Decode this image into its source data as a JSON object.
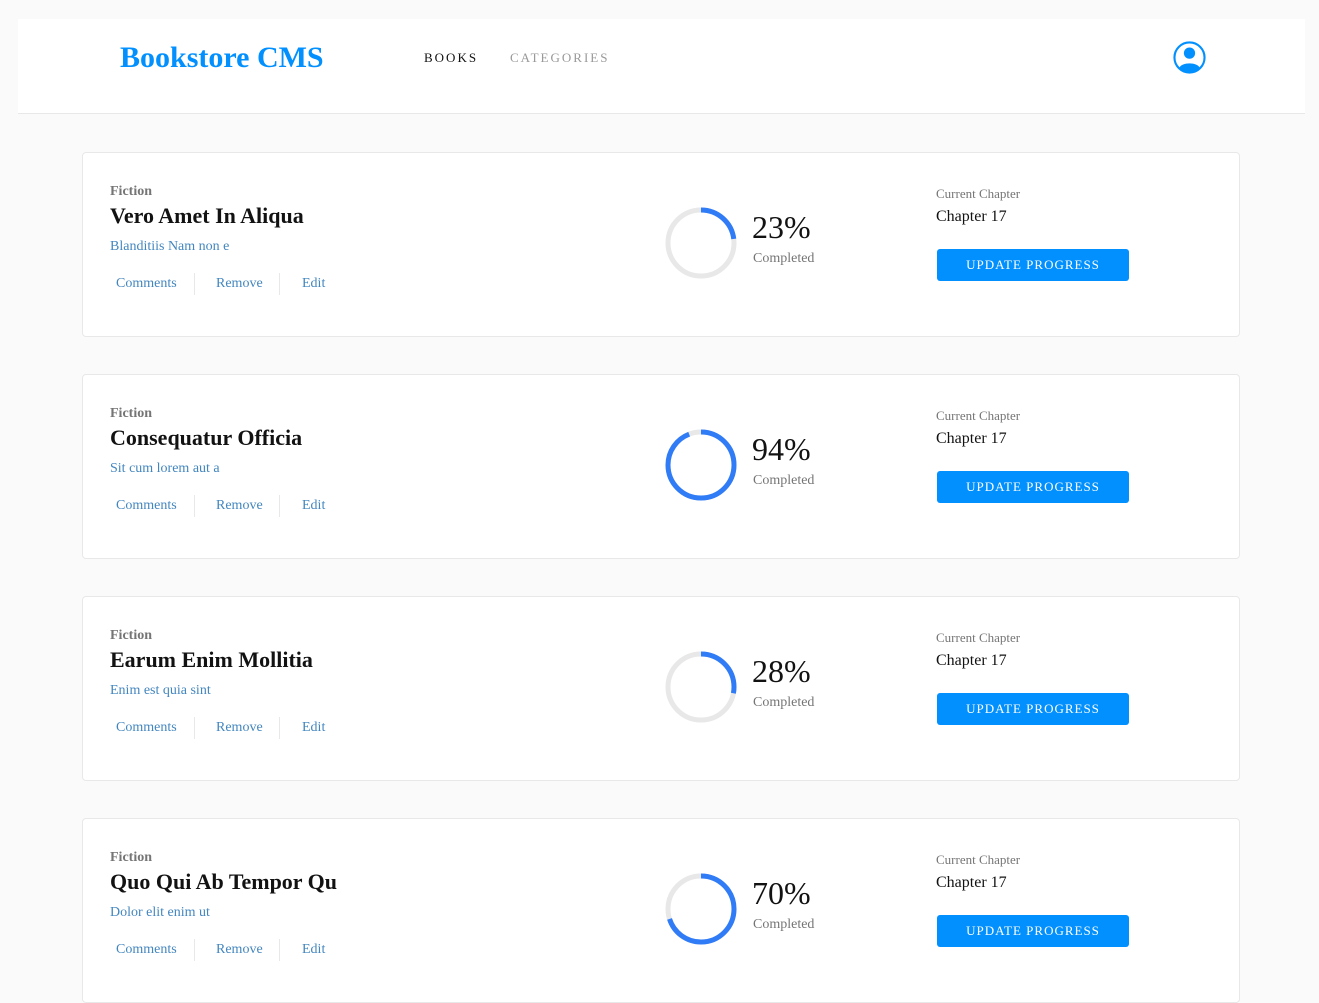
{
  "header": {
    "logo": "Bookstore CMS",
    "nav": [
      {
        "label": "BOOKS",
        "active": true
      },
      {
        "label": "CATEGORIES",
        "active": false
      }
    ],
    "user_icon": "user-circle-icon"
  },
  "colors": {
    "brand": "#0290ff",
    "ring_progress": "#307bf6",
    "ring_track": "#e8e8e8",
    "link": "#4386bf"
  },
  "labels": {
    "comments": "Comments",
    "remove": "Remove",
    "edit": "Edit",
    "completed": "Completed",
    "current_chapter": "Current Chapter",
    "update_progress": "UPDATE PROGRESS"
  },
  "books": [
    {
      "genre": "Fiction",
      "title": "Vero Amet In Aliqua",
      "author": "Blanditiis Nam non e",
      "progress": 23,
      "percent_label": "23%",
      "chapter": "Chapter 17"
    },
    {
      "genre": "Fiction",
      "title": "Consequatur Officia",
      "author": "Sit cum lorem aut a",
      "progress": 94,
      "percent_label": "94%",
      "chapter": "Chapter 17"
    },
    {
      "genre": "Fiction",
      "title": "Earum Enim Mollitia",
      "author": "Enim est quia sint",
      "progress": 28,
      "percent_label": "28%",
      "chapter": "Chapter 17"
    },
    {
      "genre": "Fiction",
      "title": "Quo Qui Ab Tempor Qu",
      "author": "Dolor elit enim ut",
      "progress": 70,
      "percent_label": "70%",
      "chapter": "Chapter 17"
    }
  ]
}
